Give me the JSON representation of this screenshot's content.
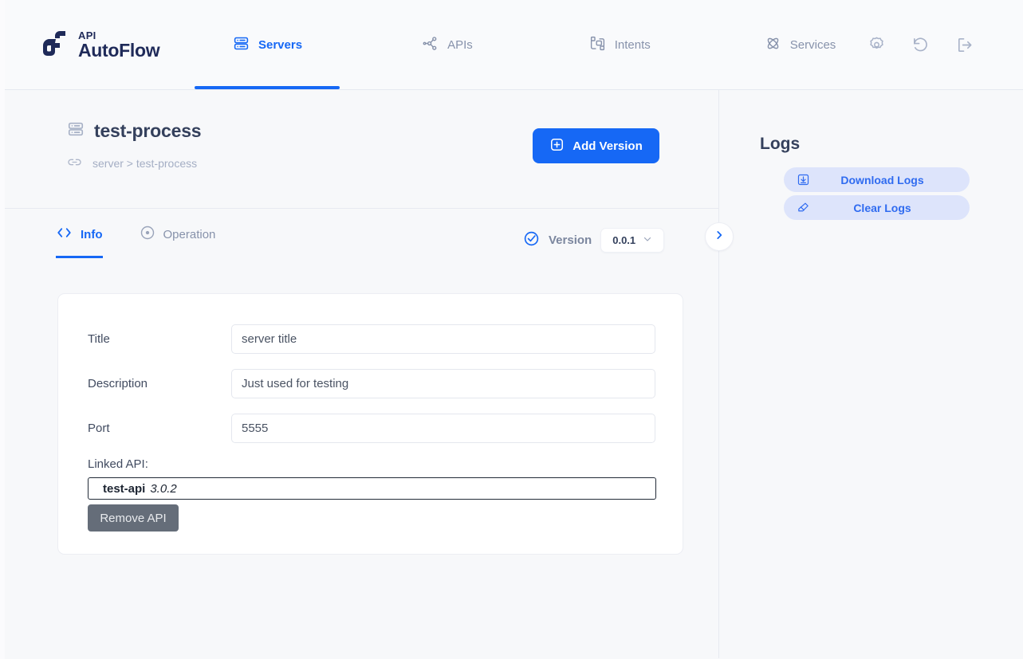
{
  "brand": {
    "small": "API",
    "name": "AutoFlow",
    "logo_icon": "autoflow-logo-mark"
  },
  "nav": {
    "items": [
      {
        "label": "Servers",
        "icon": "server-icon",
        "active": true
      },
      {
        "label": "APIs",
        "icon": "api-network-icon",
        "active": false
      },
      {
        "label": "Intents",
        "icon": "intents-boxes-icon",
        "active": false
      },
      {
        "label": "Services",
        "icon": "services-atom-icon",
        "active": false
      }
    ],
    "actions": [
      {
        "name": "settings-icon",
        "label": "Settings"
      },
      {
        "name": "history-undo-icon",
        "label": "History"
      },
      {
        "name": "logout-icon",
        "label": "Logout"
      }
    ]
  },
  "page": {
    "title": "test-process",
    "title_icon": "server-icon",
    "breadcrumb": "server > test-process",
    "breadcrumb_icon": "link-icon",
    "add_version_label": "Add Version",
    "add_version_icon": "plus-square-icon",
    "panel_toggle_icon": "chevron-right-icon"
  },
  "tabs": [
    {
      "label": "Info",
      "icon": "code-brackets-icon",
      "active": true
    },
    {
      "label": "Operation",
      "icon": "dot-circle-icon",
      "active": false
    }
  ],
  "version": {
    "icon": "check-circle-icon",
    "label": "Version",
    "selected": "0.0.1",
    "chevron": "chevron-down-icon"
  },
  "form": {
    "fields": [
      {
        "label": "Title",
        "value": "server title",
        "placeholder": "server title"
      },
      {
        "label": "Description",
        "value": "Just used for testing",
        "placeholder": "Just used for testing"
      },
      {
        "label": "Port",
        "value": "5555",
        "placeholder": "5555"
      }
    ],
    "linked_api": {
      "label": "Linked API:",
      "name": "test-api",
      "version": "3.0.2",
      "remove_label": "Remove API"
    }
  },
  "logs": {
    "title": "Logs",
    "buttons": [
      {
        "label": "Download Logs",
        "icon": "download-box-icon"
      },
      {
        "label": "Clear Logs",
        "icon": "eraser-icon"
      }
    ]
  },
  "colors": {
    "accent": "#1668f5",
    "nav_inactive": "#8792ab",
    "title": "#34405c",
    "log_button_bg": "#dde4fb",
    "remove_button_bg": "#656d79"
  }
}
